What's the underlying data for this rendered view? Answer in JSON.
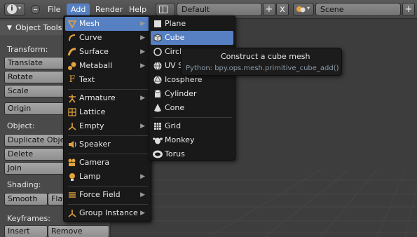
{
  "topbar": {
    "info_icon": "info-icon",
    "menus": [
      "File",
      "Add",
      "Render",
      "Help"
    ],
    "layout_name": "Default",
    "scene_name": "Scene",
    "plus_label": "+",
    "close_label": "x"
  },
  "toolshelf": {
    "title": "Object Tools",
    "sections": {
      "transform": "Transform:",
      "object": "Object:",
      "shading": "Shading:",
      "keyframes": "Keyframes:"
    },
    "buttons": {
      "translate": "Translate",
      "rotate": "Rotate",
      "scale": "Scale",
      "origin": "Origin",
      "duplicate": "Duplicate Objects",
      "delete": "Delete",
      "join": "Join",
      "smooth": "Smooth",
      "flat": "Flat",
      "insert": "Insert",
      "remove": "Remove"
    }
  },
  "add_menu": {
    "items": [
      {
        "label": "Mesh",
        "icon": "mesh-icon",
        "submenu": true,
        "active": true
      },
      {
        "label": "Curve",
        "icon": "curve-icon",
        "submenu": true
      },
      {
        "label": "Surface",
        "icon": "surface-icon",
        "submenu": true
      },
      {
        "label": "Metaball",
        "icon": "metaball-icon",
        "submenu": true
      },
      {
        "label": "Text",
        "icon": "text-icon"
      },
      {
        "label": "Armature",
        "icon": "armature-icon",
        "submenu": true
      },
      {
        "label": "Lattice",
        "icon": "lattice-icon"
      },
      {
        "label": "Empty",
        "icon": "empty-icon",
        "submenu": true
      },
      {
        "label": "Speaker",
        "icon": "speaker-icon"
      },
      {
        "label": "Camera",
        "icon": "camera-icon"
      },
      {
        "label": "Lamp",
        "icon": "lamp-icon",
        "submenu": true
      },
      {
        "label": "Force Field",
        "icon": "force-field-icon",
        "submenu": true
      },
      {
        "label": "Group Instance",
        "icon": "group-instance-icon",
        "submenu": true
      }
    ]
  },
  "mesh_menu": {
    "items": [
      {
        "label": "Plane",
        "icon": "plane-icon"
      },
      {
        "label": "Cube",
        "icon": "cube-icon",
        "active": true
      },
      {
        "label": "Circle",
        "icon": "circle-icon"
      },
      {
        "label": "UV Sphere",
        "icon": "uv-sphere-icon"
      },
      {
        "label": "Icosphere",
        "icon": "icosphere-icon"
      },
      {
        "label": "Cylinder",
        "icon": "cylinder-icon"
      },
      {
        "label": "Cone",
        "icon": "cone-icon"
      },
      {
        "label": "Grid",
        "icon": "grid-icon"
      },
      {
        "label": "Monkey",
        "icon": "monkey-icon"
      },
      {
        "label": "Torus",
        "icon": "torus-icon"
      }
    ]
  },
  "tooltip": {
    "title": "Construct a cube mesh",
    "python": "Python: bpy.ops.mesh.primitive_cube_add()"
  },
  "colors": {
    "highlight": "#5680c2",
    "menu_bg": "#191919",
    "icon_orange": "#e3a33c"
  }
}
